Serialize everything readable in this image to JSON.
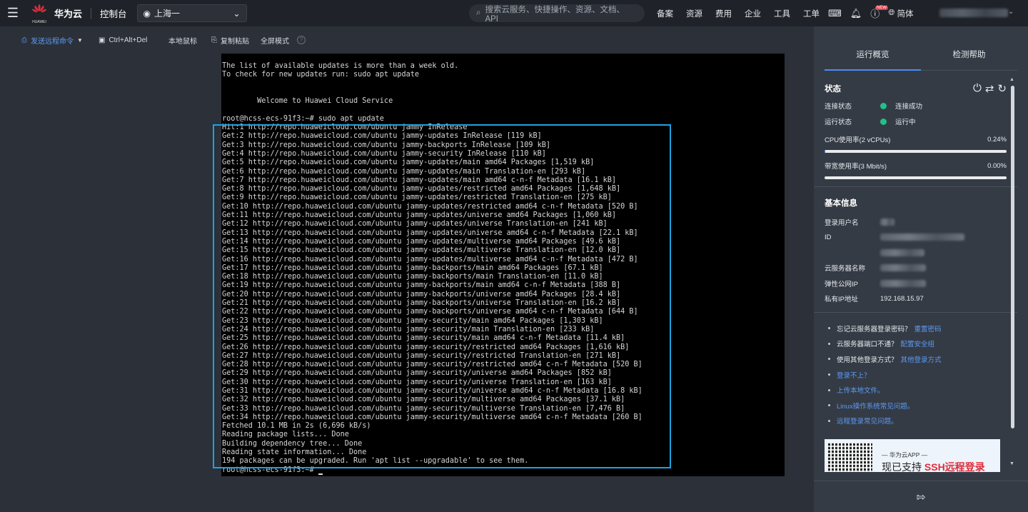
{
  "topnav": {
    "logo_text": "HUAWEI",
    "brand": "华为云",
    "console": "控制台",
    "region": "上海一",
    "search_placeholder": "搜索云服务、快捷操作、资源、文档、API",
    "links": [
      "备案",
      "资源",
      "费用",
      "企业",
      "工具",
      "工单"
    ],
    "new_badge": "NEW",
    "language": "简体"
  },
  "toolbar": {
    "send_command": "发送远程命令",
    "ctrl_alt_del": "Ctrl+Alt+Del",
    "local_mouse": "本地鼠标",
    "copy_paste": "复制粘贴",
    "fullscreen": "全屏模式"
  },
  "terminal": {
    "lines": [
      "The list of available updates is more than a week old.",
      "To check for new updates run: sudo apt update",
      "",
      "",
      "        Welcome to Huawei Cloud Service",
      "",
      "root@hcss-ecs-91f3:~# sudo apt update",
      "Hit:1 http://repo.huaweicloud.com/ubuntu jammy InRelease",
      "Get:2 http://repo.huaweicloud.com/ubuntu jammy-updates InRelease [119 kB]",
      "Get:3 http://repo.huaweicloud.com/ubuntu jammy-backports InRelease [109 kB]",
      "Get:4 http://repo.huaweicloud.com/ubuntu jammy-security InRelease [110 kB]",
      "Get:5 http://repo.huaweicloud.com/ubuntu jammy-updates/main amd64 Packages [1,519 kB]",
      "Get:6 http://repo.huaweicloud.com/ubuntu jammy-updates/main Translation-en [293 kB]",
      "Get:7 http://repo.huaweicloud.com/ubuntu jammy-updates/main amd64 c-n-f Metadata [16.1 kB]",
      "Get:8 http://repo.huaweicloud.com/ubuntu jammy-updates/restricted amd64 Packages [1,648 kB]",
      "Get:9 http://repo.huaweicloud.com/ubuntu jammy-updates/restricted Translation-en [275 kB]",
      "Get:10 http://repo.huaweicloud.com/ubuntu jammy-updates/restricted amd64 c-n-f Metadata [520 B]",
      "Get:11 http://repo.huaweicloud.com/ubuntu jammy-updates/universe amd64 Packages [1,060 kB]",
      "Get:12 http://repo.huaweicloud.com/ubuntu jammy-updates/universe Translation-en [241 kB]",
      "Get:13 http://repo.huaweicloud.com/ubuntu jammy-updates/universe amd64 c-n-f Metadata [22.1 kB]",
      "Get:14 http://repo.huaweicloud.com/ubuntu jammy-updates/multiverse amd64 Packages [49.6 kB]",
      "Get:15 http://repo.huaweicloud.com/ubuntu jammy-updates/multiverse Translation-en [12.0 kB]",
      "Get:16 http://repo.huaweicloud.com/ubuntu jammy-updates/multiverse amd64 c-n-f Metadata [472 B]",
      "Get:17 http://repo.huaweicloud.com/ubuntu jammy-backports/main amd64 Packages [67.1 kB]",
      "Get:18 http://repo.huaweicloud.com/ubuntu jammy-backports/main Translation-en [11.0 kB]",
      "Get:19 http://repo.huaweicloud.com/ubuntu jammy-backports/main amd64 c-n-f Metadata [388 B]",
      "Get:20 http://repo.huaweicloud.com/ubuntu jammy-backports/universe amd64 Packages [28.4 kB]",
      "Get:21 http://repo.huaweicloud.com/ubuntu jammy-backports/universe Translation-en [16.2 kB]",
      "Get:22 http://repo.huaweicloud.com/ubuntu jammy-backports/universe amd64 c-n-f Metadata [644 B]",
      "Get:23 http://repo.huaweicloud.com/ubuntu jammy-security/main amd64 Packages [1,303 kB]",
      "Get:24 http://repo.huaweicloud.com/ubuntu jammy-security/main Translation-en [233 kB]",
      "Get:25 http://repo.huaweicloud.com/ubuntu jammy-security/main amd64 c-n-f Metadata [11.4 kB]",
      "Get:26 http://repo.huaweicloud.com/ubuntu jammy-security/restricted amd64 Packages [1,616 kB]",
      "Get:27 http://repo.huaweicloud.com/ubuntu jammy-security/restricted Translation-en [271 kB]",
      "Get:28 http://repo.huaweicloud.com/ubuntu jammy-security/restricted amd64 c-n-f Metadata [520 B]",
      "Get:29 http://repo.huaweicloud.com/ubuntu jammy-security/universe amd64 Packages [852 kB]",
      "Get:30 http://repo.huaweicloud.com/ubuntu jammy-security/universe Translation-en [163 kB]",
      "Get:31 http://repo.huaweicloud.com/ubuntu jammy-security/universe amd64 c-n-f Metadata [16.8 kB]",
      "Get:32 http://repo.huaweicloud.com/ubuntu jammy-security/multiverse amd64 Packages [37.1 kB]",
      "Get:33 http://repo.huaweicloud.com/ubuntu jammy-security/multiverse Translation-en [7,476 B]",
      "Get:34 http://repo.huaweicloud.com/ubuntu jammy-security/multiverse amd64 c-n-f Metadata [260 B]",
      "Fetched 10.1 MB in 2s (6,696 kB/s)",
      "Reading package lists... Done",
      "Building dependency tree... Done",
      "Reading state information... Done",
      "194 packages can be upgraded. Run 'apt list --upgradable' to see them."
    ],
    "prompt": "root@hcss-ecs-91f3:~# "
  },
  "panel": {
    "tabs": [
      "运行概览",
      "检测帮助"
    ],
    "status": {
      "title": "状态",
      "connection_label": "连接状态",
      "connection_value": "连接成功",
      "running_label": "运行状态",
      "running_value": "运行中",
      "cpu_label": "CPU使用率(2 vCPUs)",
      "cpu_value": "0.24%",
      "cpu_fraction": 0.0024,
      "bandwidth_label": "带宽使用率(3 Mbit/s)",
      "bandwidth_value": "0.00%",
      "bandwidth_fraction": 0.0
    },
    "basic": {
      "title": "基本信息",
      "user_label": "登录用户名",
      "id_label": "ID",
      "name_label": "云服务器名称",
      "eip_label": "弹性公网IP",
      "private_ip_label": "私有IP地址",
      "private_ip_value": "192.168.15.97"
    },
    "help": {
      "q1": "忘记云服务器登录密码？",
      "q1_link": "重置密码",
      "q2": "云服务器端口不通？",
      "q2_link": "配置安全组",
      "q3": "使用其他登录方式？",
      "q3_link": "其他登录方式",
      "l4": "登录不上？",
      "l5": "上传本地文件。",
      "l6": "Linux操作系统常见问题。",
      "l7": "远程登录常见问题。"
    },
    "ad": {
      "small": "— 华为云APP —",
      "big_prefix": "现已支持 ",
      "big_highlight": "SSH远程登录"
    }
  }
}
